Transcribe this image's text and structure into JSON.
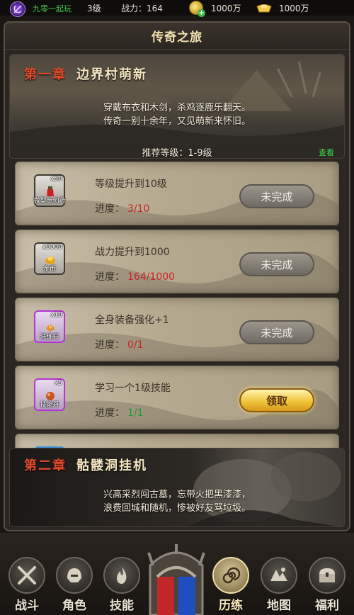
{
  "topbar": {
    "player_name": "九零一起玩",
    "level": "3级",
    "power": "战力：164",
    "gold": "1000万",
    "ingot": "1000万"
  },
  "panel": {
    "title": "传奇之旅"
  },
  "chapter1": {
    "title_prefix": "第一章",
    "title_name": "边界村萌新",
    "verse_line1": "穿戴布衣和木剑，杀鸡逐鹿乐翻天。",
    "verse_line2": "传奇一别十余年，又见萌新来怀旧。",
    "recommend": "推荐等级：1-9级",
    "view_label": "查看"
  },
  "tasks": [
    {
      "desc": "等级提升到10级",
      "progress_label": "进度：",
      "progress_value": "3/10",
      "progress_status": "red",
      "reward_name": "微型金创药",
      "reward_count": "x50",
      "reward_rarity": "normal",
      "button_label": "未完成",
      "button_state": "incomplete"
    },
    {
      "desc": "战力提升到1000",
      "progress_label": "进度：",
      "progress_value": "164/1000",
      "progress_status": "red",
      "reward_name": "金币",
      "reward_count": "x3000",
      "reward_rarity": "normal",
      "button_label": "未完成",
      "button_state": "incomplete"
    },
    {
      "desc": "全身装备强化+1",
      "progress_label": "进度：",
      "progress_value": "0/1",
      "progress_status": "red",
      "reward_name": "洗练石",
      "reward_count": "x10",
      "reward_rarity": "purple",
      "button_label": "未完成",
      "button_state": "incomplete"
    },
    {
      "desc": "学习一个1级技能",
      "progress_label": "进度：",
      "progress_value": "1/1",
      "progress_status": "green",
      "reward_name": "技能丹",
      "reward_count": "x5",
      "reward_rarity": "purple",
      "button_label": "领取",
      "button_state": "claim"
    }
  ],
  "chapter2": {
    "title_prefix": "第二章",
    "title_name": "骷髅洞挂机",
    "verse_line1": "兴高采烈闯古墓，忘带火把黑漆漆，",
    "verse_line2": "浪费回城和随机，惨被好友骂垃圾。"
  },
  "nav": {
    "items": [
      {
        "label": "战斗",
        "icon": "crossed-swords-icon"
      },
      {
        "label": "角色",
        "icon": "helmet-icon"
      },
      {
        "label": "技能",
        "icon": "flame-icon"
      },
      {
        "label": "历练",
        "icon": "spiral-icon",
        "active": true
      },
      {
        "label": "地图",
        "icon": "map-icon"
      },
      {
        "label": "福利",
        "icon": "chest-icon"
      }
    ]
  },
  "colors": {
    "progress_red": "#c9242a",
    "progress_green": "#1f9a37",
    "chapter_title_red": "#e34a2c",
    "player_name_green": "#44c34b"
  }
}
